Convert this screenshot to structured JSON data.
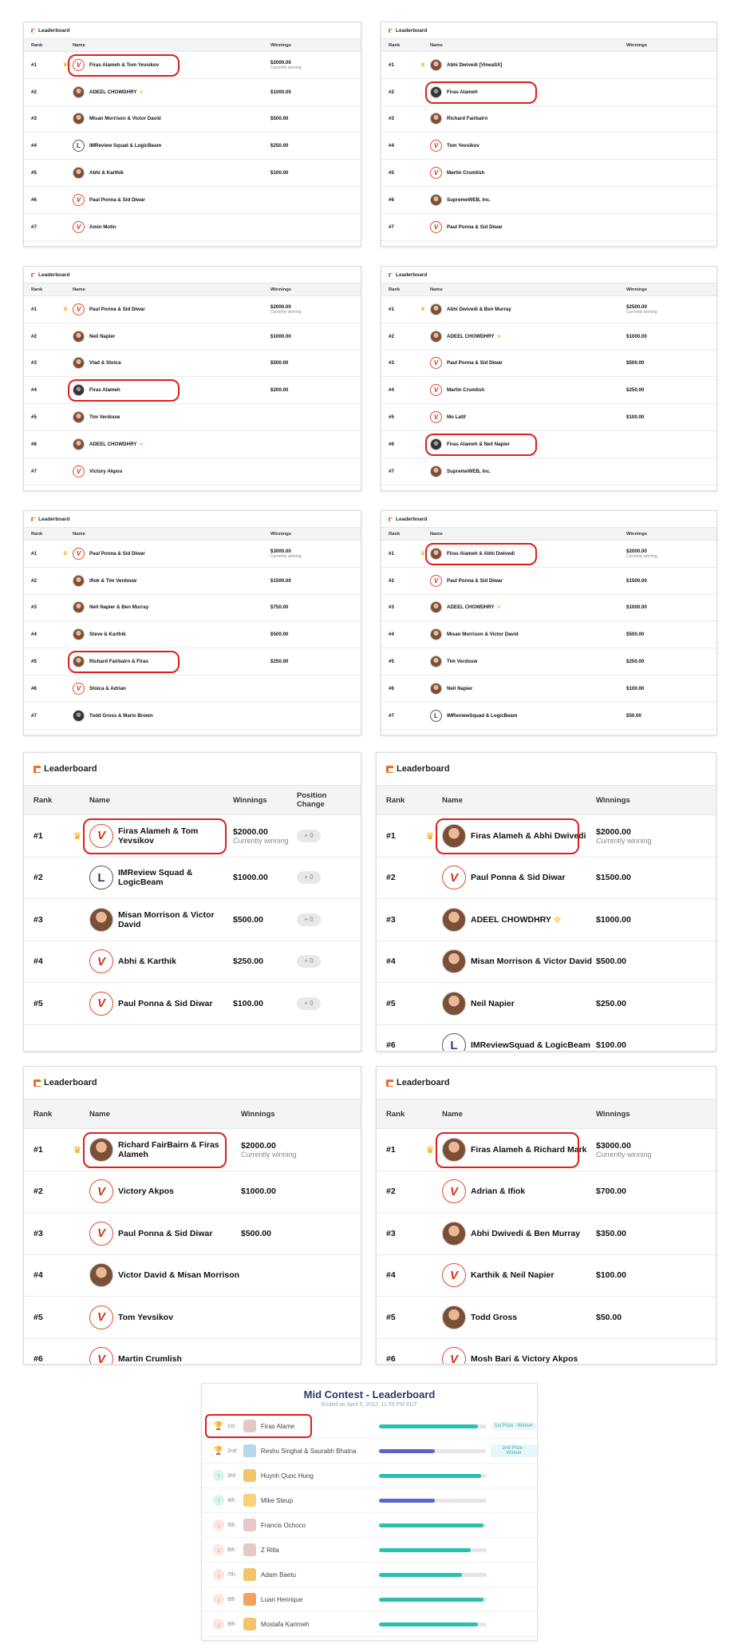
{
  "boards": [
    {
      "title": "Leaderboard",
      "cols": [
        "Rank",
        "Name",
        "Winnings"
      ],
      "rows": [
        {
          "rank": "#1",
          "crown": "♛",
          "name": "Firas Alameh & Tom Yevsikov",
          "av": "logo",
          "win": "$2000.00",
          "sub": "Currently winning"
        },
        {
          "rank": "#2",
          "name": "ADEEL CHOWDHRY",
          "av": "photo",
          "star": "☆",
          "win": "$1000.00"
        },
        {
          "rank": "#3",
          "name": "Misan Morrison & Victor David",
          "av": "photo",
          "win": "$500.00"
        },
        {
          "rank": "#4",
          "name": "IMReview Squad & LogicBeam",
          "av": "lb",
          "win": "$250.00"
        },
        {
          "rank": "#5",
          "name": "Abhi & Karthik",
          "av": "photo",
          "win": "$100.00"
        },
        {
          "rank": "#6",
          "name": "Paul Ponna & Sid Diwar",
          "av": "logo",
          "win": ""
        },
        {
          "rank": "#7",
          "name": "Amin Motin",
          "av": "logo",
          "win": ""
        }
      ]
    },
    {
      "title": "Leaderboard",
      "cols": [
        "Rank",
        "Name",
        "Winnings"
      ],
      "rows": [
        {
          "rank": "#1",
          "crown": "♛",
          "name": "Abhi Dwivedi [VineaSX]",
          "av": "photo",
          "win": ""
        },
        {
          "rank": "#2",
          "name": "Firas Alameh",
          "av": "dark",
          "win": ""
        },
        {
          "rank": "#3",
          "name": "Richard Fairbairn",
          "av": "photo",
          "win": ""
        },
        {
          "rank": "#4",
          "name": "Tom Yevsikov",
          "av": "logo",
          "win": ""
        },
        {
          "rank": "#5",
          "name": "Martin Crumlish",
          "av": "logo",
          "win": ""
        },
        {
          "rank": "#6",
          "name": "SupremeWEB, Inc.",
          "av": "photo",
          "win": ""
        },
        {
          "rank": "#7",
          "name": "Paul Ponna & Sid Diwar",
          "av": "logo",
          "win": ""
        }
      ]
    },
    {
      "title": "Leaderboard",
      "cols": [
        "Rank",
        "Name",
        "Winnings"
      ],
      "rows": [
        {
          "rank": "#1",
          "crown": "♛",
          "name": "Paul Ponna & Sid Diwar",
          "av": "logo",
          "win": "$2000.00",
          "sub": "Currently winning"
        },
        {
          "rank": "#2",
          "name": "Neil Napier",
          "av": "photo",
          "win": "$1000.00"
        },
        {
          "rank": "#3",
          "name": "Vlad & Stoica",
          "av": "photo",
          "win": "$500.00"
        },
        {
          "rank": "#4",
          "name": "Firas Alameh",
          "av": "dark",
          "win": "$200.00"
        },
        {
          "rank": "#5",
          "name": "Tim Verdouw",
          "av": "photo",
          "win": ""
        },
        {
          "rank": "#6",
          "name": "ADEEL CHOWDHRY",
          "av": "photo",
          "star": "☆",
          "win": ""
        },
        {
          "rank": "#7",
          "name": "Victory Akpos",
          "av": "logo",
          "win": ""
        }
      ]
    },
    {
      "title": "Leaderboard",
      "cols": [
        "Rank",
        "Name",
        "Winnings"
      ],
      "rows": [
        {
          "rank": "#1",
          "crown": "♛",
          "name": "Abhi Dwivedi & Ben Murray",
          "av": "photo",
          "win": "$2500.00",
          "sub": "Currently winning"
        },
        {
          "rank": "#2",
          "name": "ADEEL CHOWDHRY",
          "av": "photo",
          "star": "☆",
          "win": "$1000.00"
        },
        {
          "rank": "#3",
          "name": "Paul Ponna & Sid Diwar",
          "av": "logo",
          "win": "$500.00"
        },
        {
          "rank": "#4",
          "name": "Martin Crumlish",
          "av": "logo",
          "win": "$250.00"
        },
        {
          "rank": "#5",
          "name": "Mo Latif",
          "av": "logo",
          "win": "$100.00"
        },
        {
          "rank": "#6",
          "name": "Firas Alameh & Neil Napier",
          "av": "dark",
          "win": ""
        },
        {
          "rank": "#7",
          "name": "SupremeWEB, Inc.",
          "av": "photo",
          "win": ""
        }
      ]
    },
    {
      "title": "Leaderboard",
      "cols": [
        "Rank",
        "Name",
        "Winnings"
      ],
      "rows": [
        {
          "rank": "#1",
          "crown": "♛",
          "name": "Paul Ponna & Sid Diwar",
          "av": "logo",
          "win": "$3000.00",
          "sub": "Currently winning"
        },
        {
          "rank": "#2",
          "name": "Ifiok & Tim Verdouw",
          "av": "photo",
          "win": "$1500.00"
        },
        {
          "rank": "#3",
          "name": "Neil Napier & Ben Murray",
          "av": "photo",
          "win": "$750.00"
        },
        {
          "rank": "#4",
          "name": "Steve & Karthik",
          "av": "photo",
          "win": "$500.00"
        },
        {
          "rank": "#5",
          "name": "Richard Fairbairn & Firas",
          "av": "photo",
          "win": "$250.00"
        },
        {
          "rank": "#6",
          "name": "Stoica & Adrian",
          "av": "logo",
          "win": ""
        },
        {
          "rank": "#7",
          "name": "Todd Gross & Mario Brown",
          "av": "dark",
          "win": ""
        }
      ]
    },
    {
      "title": "Leaderboard",
      "cols": [
        "Rank",
        "Name",
        "Winnings"
      ],
      "rows": [
        {
          "rank": "#1",
          "crown": "♛",
          "name": "Firas Alameh & Abhi Dwivedi",
          "av": "photo",
          "win": "$2000.00",
          "sub": "Currently winning"
        },
        {
          "rank": "#2",
          "name": "Paul Ponna & Sid Diwar",
          "av": "logo",
          "win": "$1500.00"
        },
        {
          "rank": "#3",
          "name": "ADEEL CHOWDHRY",
          "av": "photo",
          "star": "☆",
          "win": "$1000.00"
        },
        {
          "rank": "#4",
          "name": "Misan Morrison & Victor David",
          "av": "photo",
          "win": "$500.00"
        },
        {
          "rank": "#5",
          "name": "Tim Verdouw",
          "av": "photo",
          "win": "$250.00"
        },
        {
          "rank": "#6",
          "name": "Neil Napier",
          "av": "photo",
          "win": "$100.00"
        },
        {
          "rank": "#7",
          "name": "IMReviewSquad & LogicBeam",
          "av": "lb",
          "win": "$50.00"
        }
      ]
    },
    {
      "title": "Leaderboard",
      "cols": [
        "Rank",
        "Name",
        "Winnings",
        "Position Change"
      ],
      "rows": [
        {
          "rank": "#1",
          "crown": "♛",
          "name": "Firas Alameh & Tom Yevsikov",
          "av": "logo",
          "win": "$2000.00",
          "sub": "Currently winning",
          "pc": "+ 0"
        },
        {
          "rank": "#2",
          "name": "IMReview Squad & LogicBeam",
          "av": "lb",
          "win": "$1000.00",
          "pc": "+ 0"
        },
        {
          "rank": "#3",
          "name": "Misan Morrison & Victor David",
          "av": "photo",
          "win": "$500.00",
          "pc": "+ 0"
        },
        {
          "rank": "#4",
          "name": "Abhi & Karthik",
          "av": "logo",
          "win": "$250.00",
          "pc": "+ 0"
        },
        {
          "rank": "#5",
          "name": "Paul Ponna & Sid Diwar",
          "av": "logo",
          "win": "$100.00",
          "pc": "+ 0"
        }
      ]
    },
    {
      "title": "Leaderboard",
      "cols": [
        "Rank",
        "Name",
        "Winnings"
      ],
      "rows": [
        {
          "rank": "#1",
          "crown": "♛",
          "name": "Firas Alameh & Abhi Dwivedi",
          "av": "photo",
          "win": "$2000.00",
          "sub": "Currently winning"
        },
        {
          "rank": "#2",
          "name": "Paul Ponna & Sid Diwar",
          "av": "logo",
          "win": "$1500.00"
        },
        {
          "rank": "#3",
          "name": "ADEEL CHOWDHRY",
          "av": "photo",
          "star": "☆",
          "win": "$1000.00"
        },
        {
          "rank": "#4",
          "name": "Misan Morrison & Victor David",
          "av": "photo",
          "win": "$500.00"
        },
        {
          "rank": "#5",
          "name": "Neil Napier",
          "av": "photo",
          "win": "$250.00"
        },
        {
          "rank": "#6",
          "name": "IMReviewSquad & LogicBeam",
          "av": "lb",
          "win": "$100.00"
        }
      ]
    },
    {
      "title": "Leaderboard",
      "cols": [
        "Rank",
        "Name",
        "Winnings"
      ],
      "rows": [
        {
          "rank": "#1",
          "crown": "♛",
          "name": "Richard FairBairn & Firas Alameh",
          "av": "photo",
          "win": "$2000.00",
          "sub": "Currently winning"
        },
        {
          "rank": "#2",
          "name": "Victory Akpos",
          "av": "logo",
          "win": "$1000.00"
        },
        {
          "rank": "#3",
          "name": "Paul Ponna & Sid Diwar",
          "av": "logo",
          "win": "$500.00"
        },
        {
          "rank": "#4",
          "name": "Victor David & Misan Morrison",
          "av": "photo",
          "win": ""
        },
        {
          "rank": "#5",
          "name": "Tom Yevsikov",
          "av": "logo",
          "win": ""
        },
        {
          "rank": "#6",
          "name": "Martin Crumlish",
          "av": "logo",
          "win": ""
        }
      ]
    },
    {
      "title": "Leaderboard",
      "cols": [
        "Rank",
        "Name",
        "Winnings"
      ],
      "rows": [
        {
          "rank": "#1",
          "crown": "♛",
          "name": "Firas Alameh & Richard Mark",
          "av": "photo",
          "win": "$3000.00",
          "sub": "Currently winning"
        },
        {
          "rank": "#2",
          "name": "Adrian & Ifiok",
          "av": "logo",
          "win": "$700.00"
        },
        {
          "rank": "#3",
          "name": "Abhi Dwivedi & Ben Murray",
          "av": "photo",
          "win": "$350.00"
        },
        {
          "rank": "#4",
          "name": "Karthik & Neil Napier",
          "av": "logo",
          "win": "$100.00"
        },
        {
          "rank": "#5",
          "name": "Todd Gross",
          "av": "photo",
          "win": "$50.00"
        },
        {
          "rank": "#6",
          "name": "Mosh Bari & Victory Akpos",
          "av": "logo",
          "win": ""
        }
      ]
    }
  ],
  "mid": {
    "title": "Mid Contest - Leaderboard",
    "subtitle": "Ended on April 5, 2022, 11:59 PM EDT",
    "rows": [
      {
        "rank": "1st",
        "name": "Firas Alame",
        "dir": "trophy",
        "progress": 0.92,
        "color": "#2bbfae",
        "prize": "1st Prize - Winner"
      },
      {
        "rank": "2nd",
        "name": "Reshu Singhal & Saurabh Bhatna",
        "dir": "trophy",
        "progress": 0.52,
        "color": "#5e63c9",
        "prize": "2nd Prize - Winner"
      },
      {
        "rank": "3rd",
        "name": "Huynh Quoc Hung",
        "dir": "up",
        "progress": 0.95,
        "color": "#2bbfae"
      },
      {
        "rank": "4th",
        "name": "Mike Steup",
        "dir": "up",
        "progress": 0.52,
        "color": "#5e63c9"
      },
      {
        "rank": "5th",
        "name": "Francis Ochoco",
        "dir": "down",
        "progress": 0.97,
        "color": "#2bbfae"
      },
      {
        "rank": "6th",
        "name": "Z Rilla",
        "dir": "down",
        "progress": 0.85,
        "color": "#2bbfae"
      },
      {
        "rank": "7th",
        "name": "Adam Baetu",
        "dir": "down",
        "progress": 0.77,
        "color": "#2bbfae"
      },
      {
        "rank": "8th",
        "name": "Luan Henrique",
        "dir": "down",
        "progress": 0.97,
        "color": "#2bbfae"
      },
      {
        "rank": "9th",
        "name": "Mostafa Karimeh",
        "dir": "down",
        "progress": 0.92,
        "color": "#2bbfae"
      }
    ]
  }
}
